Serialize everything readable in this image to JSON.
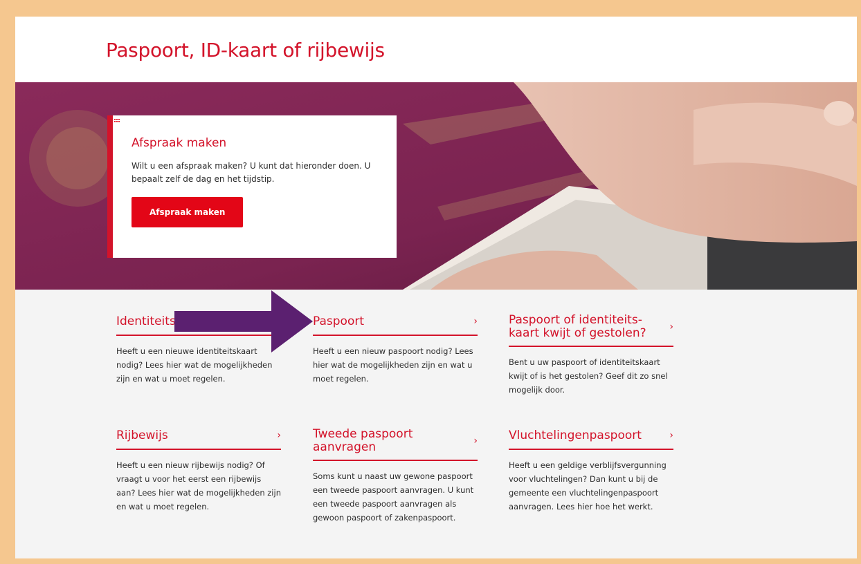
{
  "page": {
    "title": "Paspoort, ID-kaart of rijbewijs"
  },
  "hero_card": {
    "title": "Afspraak maken",
    "text": "Wilt u een afspraak maken? U kunt dat hieronder doen. U bepaalt zelf de dag en het tijdstip.",
    "button_label": "Afspraak maken",
    "button_icon": "calendar-icon"
  },
  "tiles": [
    {
      "title": "Identiteitskaart",
      "text": "Heeft u een nieuwe identiteitskaart nodig? Lees hier wat de mogelijkheden zijn en wat u moet regelen.",
      "chevron": "›"
    },
    {
      "title": "Paspoort",
      "text": "Heeft u een nieuw paspoort nodig? Lees hier wat de mogelijkheden zijn en wat u moet regelen.",
      "chevron": "›"
    },
    {
      "title": "Paspoort of identiteits-kaart kwijt of gestolen?",
      "text": "Bent u uw paspoort of identiteitskaart kwijt of is het gestolen? Geef dit zo snel mogelijk door.",
      "chevron": "›"
    },
    {
      "title": "Rijbewijs",
      "text": "Heeft u een nieuw rijbewijs nodig? Of vraagt u voor het eerst een rijbewijs aan? Lees hier wat de mogelijkheden zijn en wat u moet regelen.",
      "chevron": "›"
    },
    {
      "title": "Tweede paspoort aanvragen",
      "text": "Soms kunt u naast uw gewone paspoort een tweede paspoort aanvragen. U kunt een tweede paspoort aanvragen als gewoon paspoort of zakenpaspoort.",
      "chevron": "›"
    },
    {
      "title": "Vluchtelingenpaspoort",
      "text": "Heeft u een geldige verblijfsvergunning voor vluchtelingen? Dan kunt u bij de gemeente een vluchtelingenpaspoort aanvragen. Lees hier hoe het werkt.",
      "chevron": "›"
    }
  ],
  "colors": {
    "accent": "#d3132a",
    "button": "#e30617",
    "frame_border": "#f5c78f",
    "annotation_arrow": "#5b2070"
  }
}
